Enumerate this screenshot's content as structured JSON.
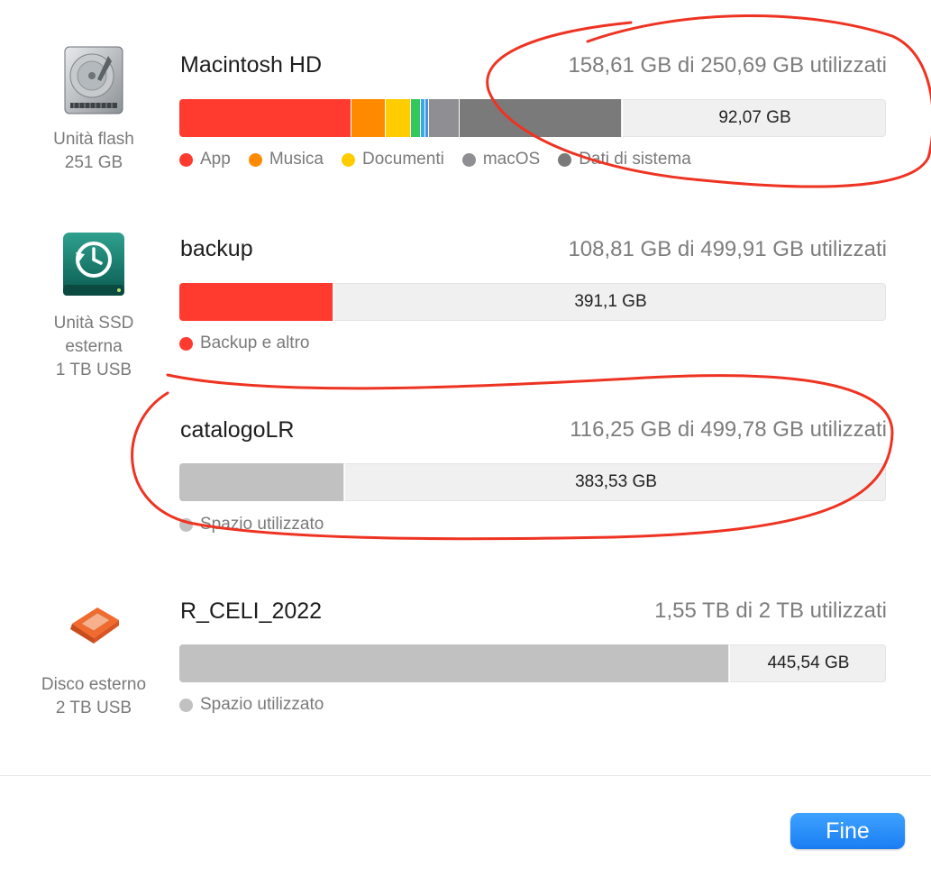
{
  "colors": {
    "app": "#ff3b30",
    "music": "#ff8a00",
    "documents": "#ffcc00",
    "green": "#34c759",
    "teal": "#32ade6",
    "blue": "#4a90e2",
    "macos": "#8e8e93",
    "system_data": "#7a7a7a",
    "used_space": "#c1c1c1",
    "annotation": "#ee3322",
    "accent": "#1a7ef3"
  },
  "drives": [
    {
      "id": "macintosh-hd",
      "icon": "hard-drive-icon",
      "caption": [
        "Unità flash",
        "251 GB"
      ],
      "name": "Macintosh HD",
      "usage": "158,61 GB di 250,69 GB utilizzati",
      "free_label": "92,07 GB",
      "used_fraction": 0.633,
      "segments": [
        {
          "category": "App",
          "fraction": 0.242
        },
        {
          "category": "Musica",
          "fraction": 0.048
        },
        {
          "category": "Documenti",
          "fraction": 0.036
        },
        {
          "category": "other-green",
          "fraction": 0.014
        },
        {
          "category": "other-teal",
          "fraction": 0.006
        },
        {
          "category": "other-blue",
          "fraction": 0.005
        },
        {
          "category": "macOS",
          "fraction": 0.044
        },
        {
          "category": "Dati di sistema",
          "fraction": 0.23
        }
      ],
      "legend": [
        {
          "label": "App",
          "color": "#ff3b30"
        },
        {
          "label": "Musica",
          "color": "#ff8a00"
        },
        {
          "label": "Documenti",
          "color": "#ffcc00"
        },
        {
          "label": "macOS",
          "color": "#8e8e93"
        },
        {
          "label": "Dati di sistema",
          "color": "#7a7a7a"
        }
      ]
    },
    {
      "id": "backup",
      "icon": "time-machine-drive-icon",
      "caption": [
        "Unità SSD",
        "esterna",
        "1 TB USB"
      ],
      "name": "backup",
      "usage": "108,81 GB di 499,91 GB utilizzati",
      "free_label": "391,1 GB",
      "used_fraction": 0.217,
      "segments": [
        {
          "category": "Backup e altro",
          "fraction": 0.217
        }
      ],
      "legend": [
        {
          "label": "Backup e altro",
          "color": "#ff3b30"
        }
      ]
    },
    {
      "id": "catalogolr",
      "icon": "",
      "caption": [],
      "name": "catalogoLR",
      "usage": "116,25 GB di 499,78 GB utilizzati",
      "free_label": "383,53 GB",
      "used_fraction": 0.232,
      "segments": [
        {
          "category": "Spazio utilizzato",
          "fraction": 0.232
        }
      ],
      "legend": [
        {
          "label": "Spazio utilizzato",
          "color": "#c1c1c1"
        }
      ]
    },
    {
      "id": "r-celi-2022",
      "icon": "external-disk-icon",
      "caption": [
        "Disco esterno",
        "2 TB USB"
      ],
      "name": "R_CELI_2022",
      "usage": "1,55 TB di 2 TB utilizzati",
      "free_label": "445,54 GB",
      "used_fraction": 0.777,
      "segments": [
        {
          "category": "Spazio utilizzato",
          "fraction": 0.777
        }
      ],
      "legend": [
        {
          "label": "Spazio utilizzato",
          "color": "#c1c1c1"
        }
      ]
    }
  ],
  "footer": {
    "done_label": "Fine"
  }
}
